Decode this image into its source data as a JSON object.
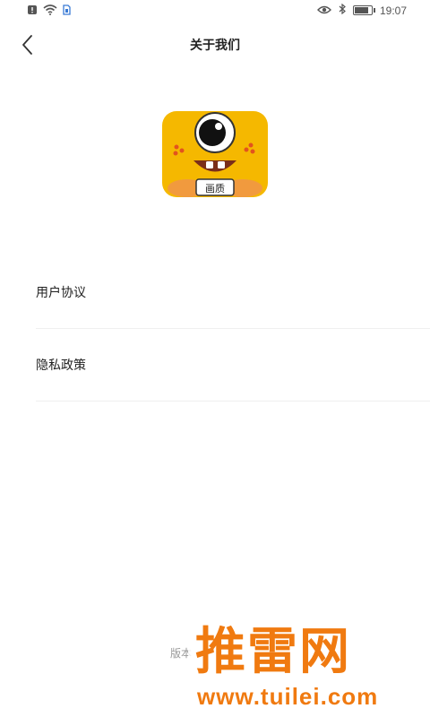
{
  "status_bar": {
    "time": "19:07",
    "icons": [
      "notification-icon",
      "wifi-icon",
      "sim-icon",
      "eye-icon",
      "bluetooth-icon",
      "battery-icon"
    ]
  },
  "header": {
    "title": "关于我们",
    "back_icon": "chevron-left-icon"
  },
  "logo": {
    "label": "画质"
  },
  "menu": {
    "items": [
      {
        "label": "用户协议"
      },
      {
        "label": "隐私政策"
      }
    ]
  },
  "footer": {
    "text": "版本"
  },
  "watermark": {
    "brand": "推雷网",
    "url": "www.tuilei.com"
  },
  "colors": {
    "background": "#ffffff",
    "text": "#222222",
    "divider": "#efefef",
    "logo_yellow": "#f5b800",
    "watermark_orange": "#f07a10"
  }
}
